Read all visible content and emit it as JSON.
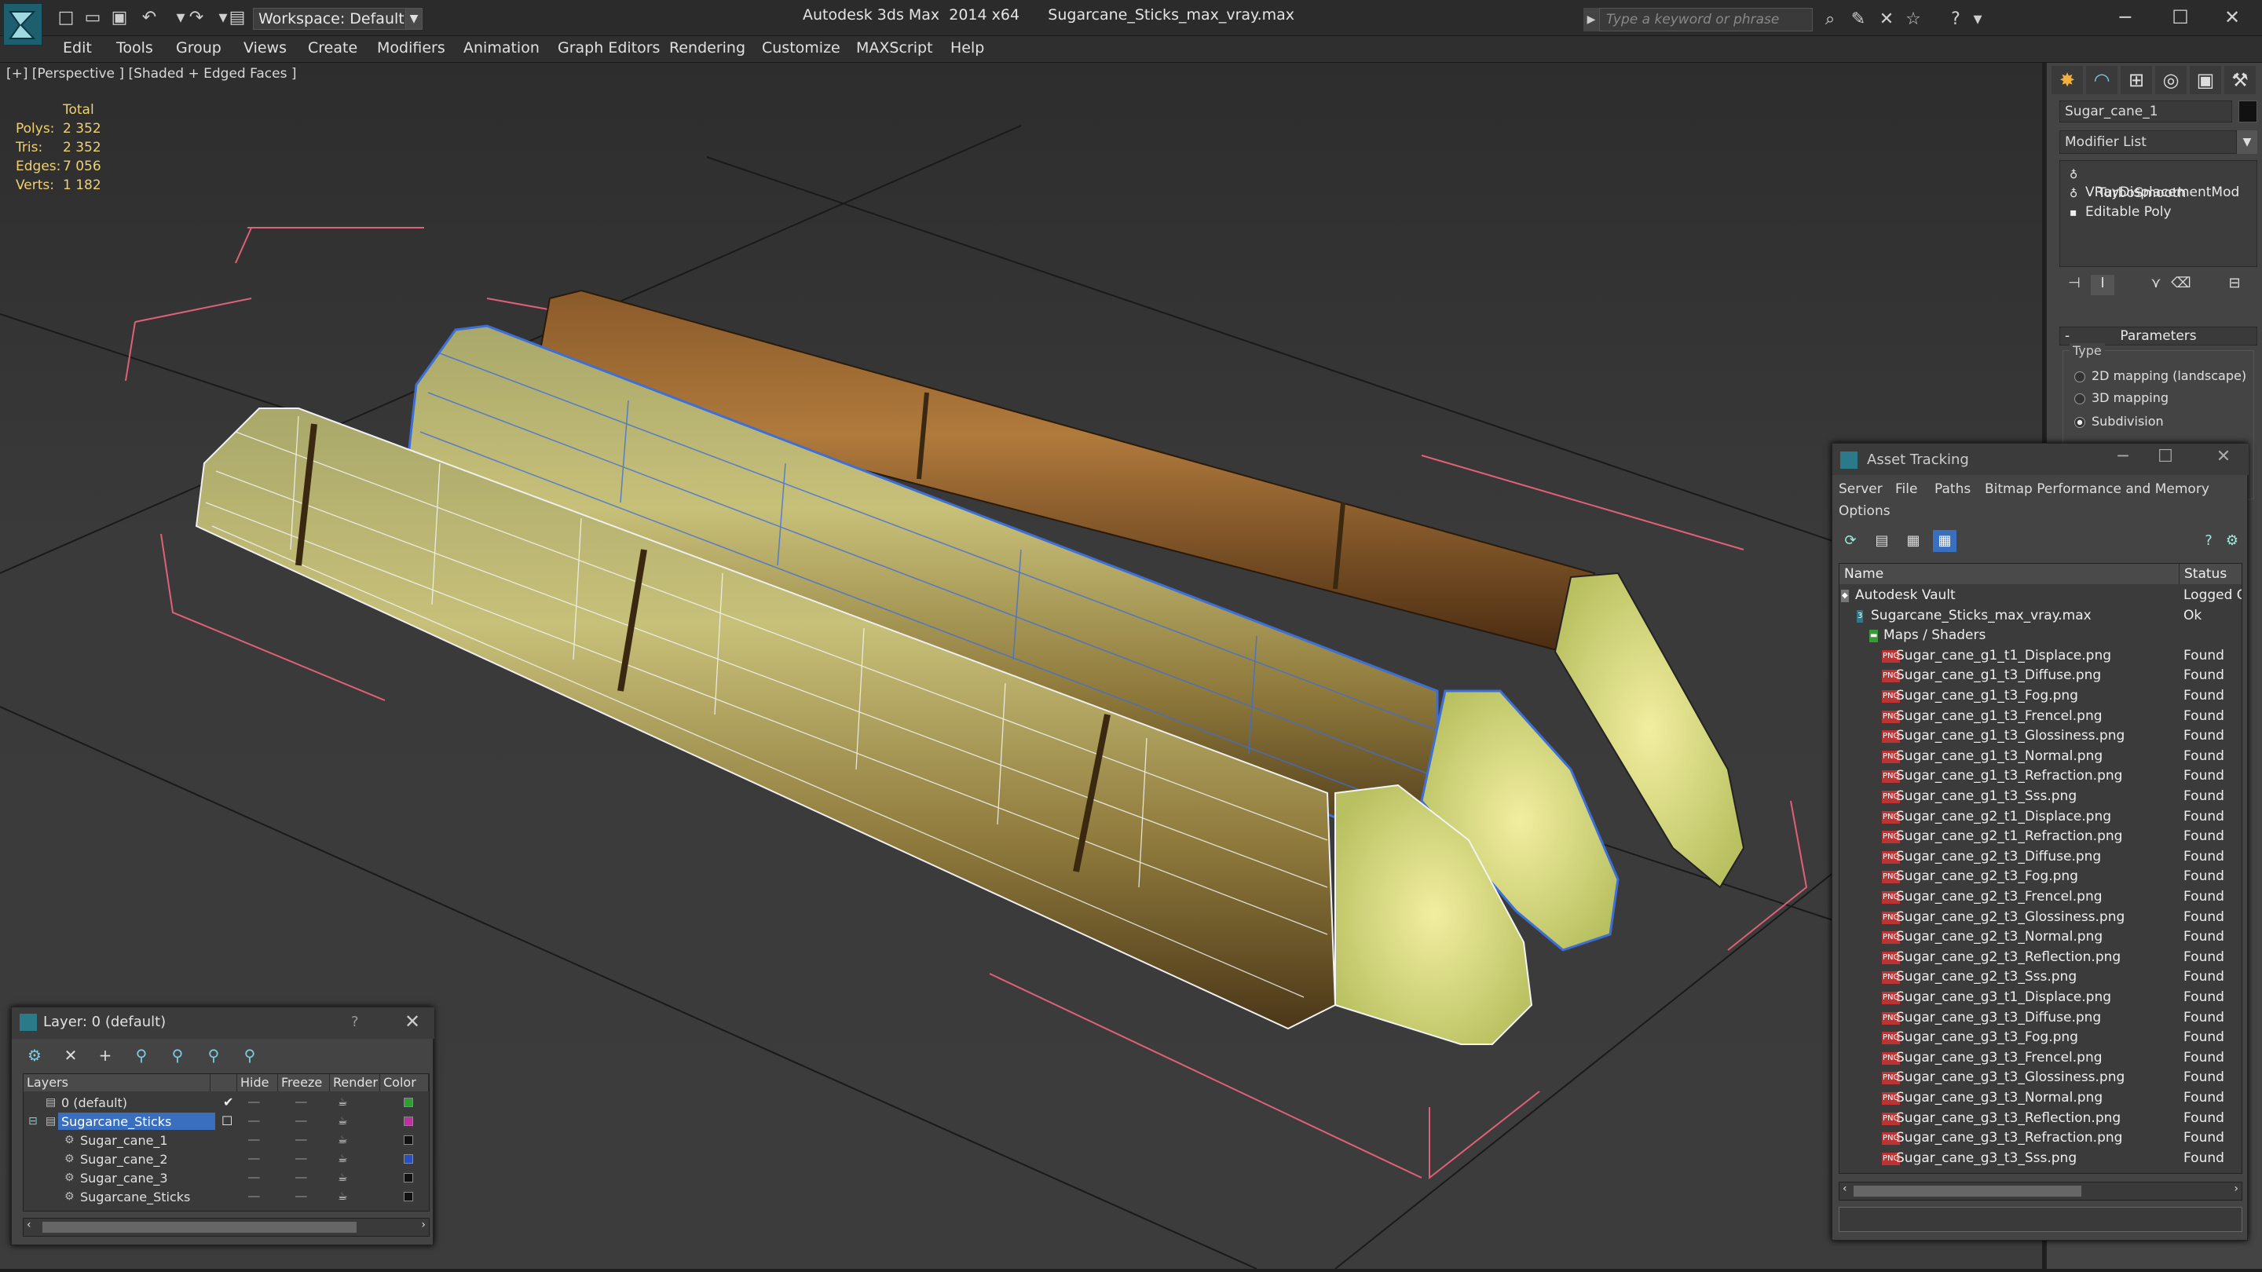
{
  "titlebar": {
    "workspace": "Workspace: Default",
    "title": "Autodesk 3ds Max  2014 x64      Sugarcane_Sticks_max_vray.max",
    "search_placeholder": "Type a keyword or phrase"
  },
  "menu": [
    "Edit",
    "Tools",
    "Group",
    "Views",
    "Create",
    "Modifiers",
    "Animation",
    "Graph Editors",
    "Rendering",
    "Customize",
    "MAXScript",
    "Help"
  ],
  "viewport": {
    "label": "[+] [Perspective ] [Shaded + Edged Faces ]",
    "stats": {
      "header": "Total",
      "rows": [
        {
          "label": "Polys:",
          "value": "2 352"
        },
        {
          "label": "Tris:",
          "value": "2 352"
        },
        {
          "label": "Edges:",
          "value": "7 056"
        },
        {
          "label": "Verts:",
          "value": "1 182"
        }
      ]
    }
  },
  "command_panel": {
    "object_name": "Sugar_cane_1",
    "modifier_list": "Modifier List",
    "stack": [
      "VRayDisplacementMod",
      "TurboSmooth",
      "Editable Poly"
    ],
    "parameters_header": "Parameters",
    "type_label": "Type",
    "type_options": [
      "2D mapping (landscape)",
      "3D mapping",
      "Subdivision"
    ],
    "type_selected": 2
  },
  "layer_dialog": {
    "title": "Layer: 0 (default)",
    "help": "?",
    "columns": [
      "Layers",
      "Hide",
      "Freeze",
      "Render",
      "Color"
    ],
    "rows": [
      {
        "name": "0 (default)",
        "indent": 1,
        "current": true,
        "color": "#2e9e2e"
      },
      {
        "name": "Sugarcane_Sticks",
        "indent": 1,
        "selected": true,
        "color": "#c02fa0"
      },
      {
        "name": "Sugar_cane_1",
        "indent": 2,
        "color": "#111111"
      },
      {
        "name": "Sugar_cane_2",
        "indent": 2,
        "color": "#2a4fc0"
      },
      {
        "name": "Sugar_cane_3",
        "indent": 2,
        "color": "#111111"
      },
      {
        "name": "Sugarcane_Sticks",
        "indent": 2,
        "color": "#111111"
      }
    ]
  },
  "asset_tracking": {
    "title": "Asset Tracking",
    "menu": [
      "Server",
      "File",
      "Paths",
      "Bitmap Performance and Memory",
      "Options"
    ],
    "columns": [
      "Name",
      "Status"
    ],
    "rows": [
      {
        "name": "Autodesk Vault",
        "status": "Logged O",
        "level": 0,
        "kind": "vault"
      },
      {
        "name": "Sugarcane_Sticks_max_vray.max",
        "status": "Ok",
        "level": 1,
        "kind": "max"
      },
      {
        "name": "Maps / Shaders",
        "status": "",
        "level": 2,
        "kind": "folder"
      },
      {
        "name": "Sugar_cane_g1_t1_Displace.png",
        "status": "Found",
        "level": 3,
        "kind": "png"
      },
      {
        "name": "Sugar_cane_g1_t3_Diffuse.png",
        "status": "Found",
        "level": 3,
        "kind": "png"
      },
      {
        "name": "Sugar_cane_g1_t3_Fog.png",
        "status": "Found",
        "level": 3,
        "kind": "png"
      },
      {
        "name": "Sugar_cane_g1_t3_Frencel.png",
        "status": "Found",
        "level": 3,
        "kind": "png"
      },
      {
        "name": "Sugar_cane_g1_t3_Glossiness.png",
        "status": "Found",
        "level": 3,
        "kind": "png"
      },
      {
        "name": "Sugar_cane_g1_t3_Normal.png",
        "status": "Found",
        "level": 3,
        "kind": "png"
      },
      {
        "name": "Sugar_cane_g1_t3_Refraction.png",
        "status": "Found",
        "level": 3,
        "kind": "png"
      },
      {
        "name": "Sugar_cane_g1_t3_Sss.png",
        "status": "Found",
        "level": 3,
        "kind": "png"
      },
      {
        "name": "Sugar_cane_g2_t1_Displace.png",
        "status": "Found",
        "level": 3,
        "kind": "png"
      },
      {
        "name": "Sugar_cane_g2_t1_Refraction.png",
        "status": "Found",
        "level": 3,
        "kind": "png"
      },
      {
        "name": "Sugar_cane_g2_t3_Diffuse.png",
        "status": "Found",
        "level": 3,
        "kind": "png"
      },
      {
        "name": "Sugar_cane_g2_t3_Fog.png",
        "status": "Found",
        "level": 3,
        "kind": "png"
      },
      {
        "name": "Sugar_cane_g2_t3_Frencel.png",
        "status": "Found",
        "level": 3,
        "kind": "png"
      },
      {
        "name": "Sugar_cane_g2_t3_Glossiness.png",
        "status": "Found",
        "level": 3,
        "kind": "png"
      },
      {
        "name": "Sugar_cane_g2_t3_Normal.png",
        "status": "Found",
        "level": 3,
        "kind": "png"
      },
      {
        "name": "Sugar_cane_g2_t3_Reflection.png",
        "status": "Found",
        "level": 3,
        "kind": "png"
      },
      {
        "name": "Sugar_cane_g2_t3_Sss.png",
        "status": "Found",
        "level": 3,
        "kind": "png"
      },
      {
        "name": "Sugar_cane_g3_t1_Displace.png",
        "status": "Found",
        "level": 3,
        "kind": "png"
      },
      {
        "name": "Sugar_cane_g3_t3_Diffuse.png",
        "status": "Found",
        "level": 3,
        "kind": "png"
      },
      {
        "name": "Sugar_cane_g3_t3_Fog.png",
        "status": "Found",
        "level": 3,
        "kind": "png"
      },
      {
        "name": "Sugar_cane_g3_t3_Frencel.png",
        "status": "Found",
        "level": 3,
        "kind": "png"
      },
      {
        "name": "Sugar_cane_g3_t3_Glossiness.png",
        "status": "Found",
        "level": 3,
        "kind": "png"
      },
      {
        "name": "Sugar_cane_g3_t3_Normal.png",
        "status": "Found",
        "level": 3,
        "kind": "png"
      },
      {
        "name": "Sugar_cane_g3_t3_Reflection.png",
        "status": "Found",
        "level": 3,
        "kind": "png"
      },
      {
        "name": "Sugar_cane_g3_t3_Refraction.png",
        "status": "Found",
        "level": 3,
        "kind": "png"
      },
      {
        "name": "Sugar_cane_g3_t3_Sss.png",
        "status": "Found",
        "level": 3,
        "kind": "png"
      }
    ]
  },
  "icons": {
    "file_png": "PNG"
  },
  "colors": {
    "accent_selection": "#3a6fbf",
    "stats_text": "#f0d070",
    "bbox_lines": "#e0607a"
  }
}
